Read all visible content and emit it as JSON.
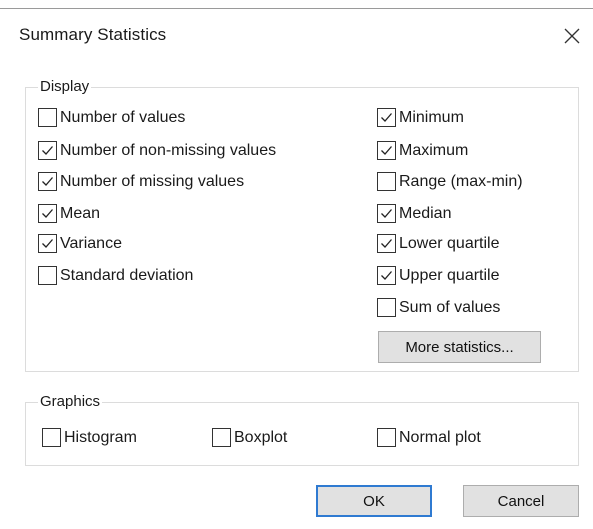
{
  "dialog": {
    "title": "Summary Statistics"
  },
  "display": {
    "label": "Display",
    "left_items": [
      {
        "label": "Number of values",
        "checked": false
      },
      {
        "label": "Number of non-missing values",
        "checked": true
      },
      {
        "label": "Number of missing values",
        "checked": true
      },
      {
        "label": "Mean",
        "checked": true
      },
      {
        "label": "Variance",
        "checked": true
      },
      {
        "label": "Standard deviation",
        "checked": false
      }
    ],
    "right_items": [
      {
        "label": "Minimum",
        "checked": true
      },
      {
        "label": "Maximum",
        "checked": true
      },
      {
        "label": "Range (max-min)",
        "checked": false
      },
      {
        "label": "Median",
        "checked": true
      },
      {
        "label": "Lower quartile",
        "checked": true
      },
      {
        "label": "Upper quartile",
        "checked": true
      },
      {
        "label": "Sum of values",
        "checked": false
      }
    ],
    "more_button": "More statistics..."
  },
  "graphics": {
    "label": "Graphics",
    "items": [
      {
        "label": "Histogram",
        "checked": false
      },
      {
        "label": "Boxplot",
        "checked": false
      },
      {
        "label": "Normal plot",
        "checked": false
      }
    ]
  },
  "buttons": {
    "ok": "OK",
    "cancel": "Cancel"
  },
  "icons": {
    "close": "close-icon",
    "checkmark": "checkmark-icon"
  },
  "colors": {
    "ok_border": "#2f7ad1",
    "button_face": "#e1e1e1"
  }
}
